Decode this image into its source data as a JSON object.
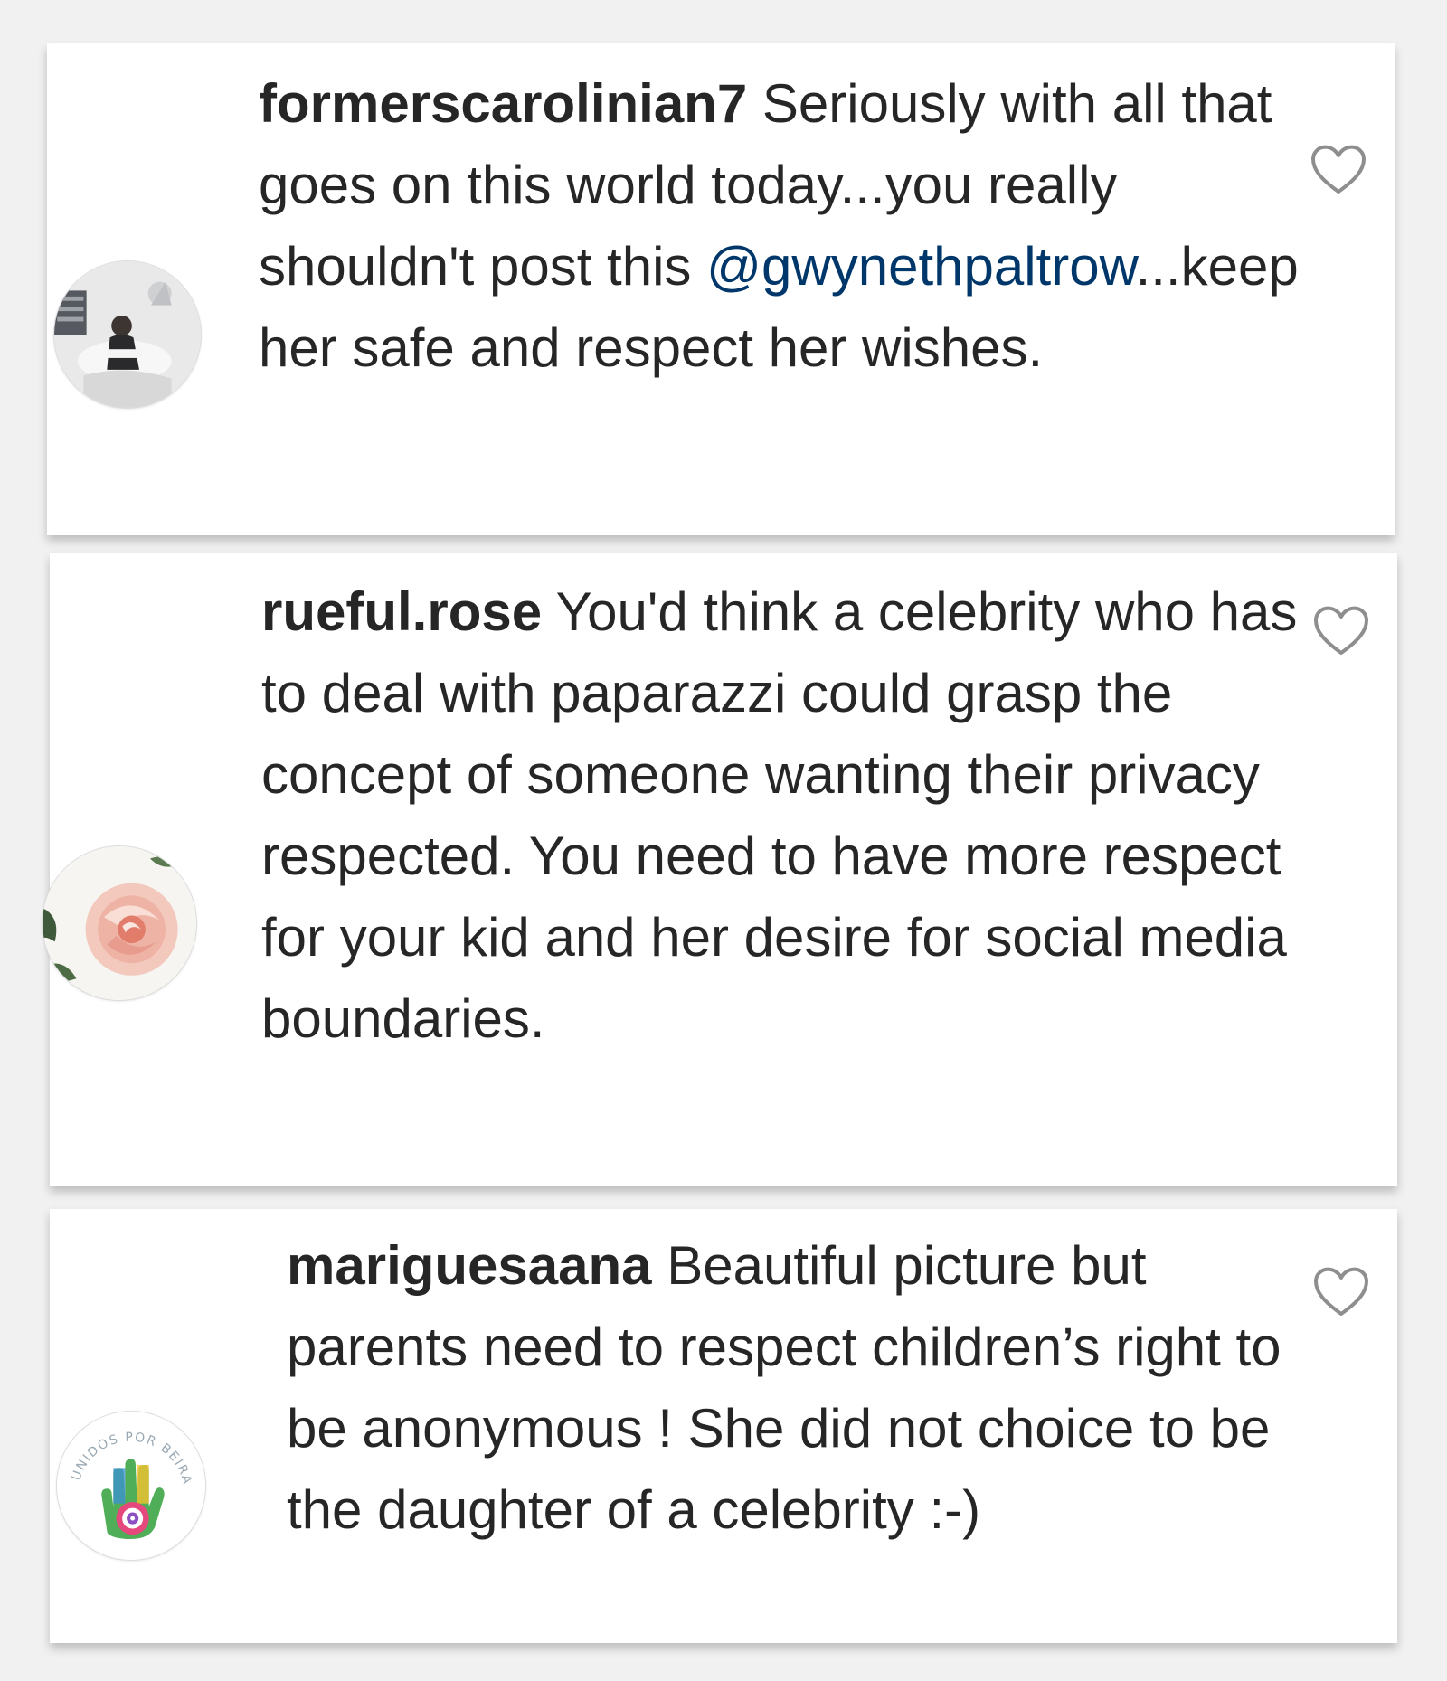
{
  "comments": [
    {
      "username": "formerscarolinian7",
      "text_before_mention": " Seriously with all that goes on this world today...you really shouldn't post this ",
      "mention": "@gwynethpaltrow",
      "text_after_mention": "...keep her safe and respect her wishes.",
      "avatar_icon": "profile-photo-person",
      "like_icon": "heart-outline-icon"
    },
    {
      "username": "rueful.rose",
      "text": " You'd think a celebrity who has to deal with paparazzi could grasp the concept of someone wanting their privacy respected. You need to have more respect for your kid and her desire for social media boundaries.",
      "avatar_icon": "profile-photo-rose",
      "like_icon": "heart-outline-icon"
    },
    {
      "username": "mariguesaana",
      "text": " Beautiful picture but parents need to respect children’s right to be anonymous ! She did not choice to be the daughter of a celebrity :-)",
      "avatar_icon": "profile-logo-hand",
      "avatar_logo_text": "UNIDOS POR BEIRA",
      "like_icon": "heart-outline-icon"
    }
  ],
  "colors": {
    "text": "#262626",
    "mention": "#00376b",
    "background": "#f1f1f1",
    "card": "#ffffff"
  }
}
